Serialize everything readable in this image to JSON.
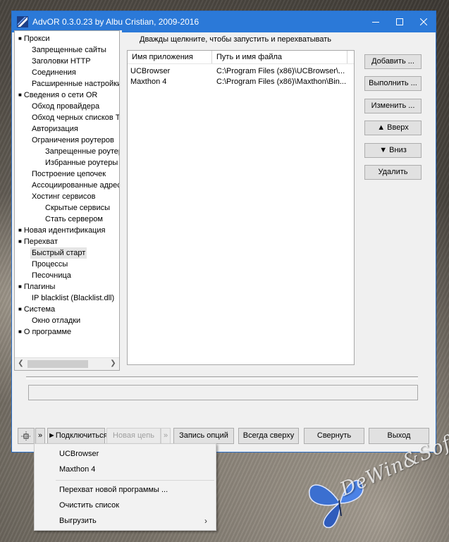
{
  "window": {
    "title": "AdvOR  0.3.0.23 by Albu Cristian, 2009-2016",
    "titlebar_color": "#2b79d8"
  },
  "tree": {
    "items": [
      {
        "label": "Прокси",
        "bullet": true
      },
      {
        "label": "Запрещенные сайты"
      },
      {
        "label": "Заголовки HTTP"
      },
      {
        "label": "Соединения"
      },
      {
        "label": "Расширенные настройки"
      },
      {
        "label": "Сведения о сети OR",
        "bullet": true
      },
      {
        "label": "Обход провайдера"
      },
      {
        "label": "Обход черных списков Т"
      },
      {
        "label": "Авторизация"
      },
      {
        "label": "Ограничения роутеров"
      },
      {
        "label": "Запрещенные роутеры"
      },
      {
        "label": "Избранные роутеры"
      },
      {
        "label": "Построение цепочек"
      },
      {
        "label": "Ассоциированные адрес"
      },
      {
        "label": "Хостинг сервисов"
      },
      {
        "label": "Скрытые сервисы"
      },
      {
        "label": "Стать сервером"
      },
      {
        "label": "Новая идентификация",
        "bullet": true
      },
      {
        "label": "Перехват",
        "bullet": true
      },
      {
        "label": "Быстрый старт",
        "selected": true
      },
      {
        "label": "Процессы"
      },
      {
        "label": "Песочница"
      },
      {
        "label": "Плагины",
        "bullet": true
      },
      {
        "label": "IP blacklist (Blacklist.dll)"
      },
      {
        "label": "Система",
        "bullet": true
      },
      {
        "label": "Окно отладки"
      },
      {
        "label": "О программе",
        "bullet": true
      }
    ]
  },
  "panel": {
    "hint": "Дважды щелкните, чтобы запустить и перехватывать",
    "columns": [
      "Имя приложения",
      "Путь и имя файла"
    ],
    "rows": [
      [
        "UCBrowser",
        "C:\\Program Files (x86)\\UCBrowser\\..."
      ],
      [
        "Maxthon 4",
        "C:\\Program Files (x86)\\Maxthon\\Bin..."
      ]
    ],
    "buttons": [
      "Добавить ...",
      "Выполнить ...",
      "Изменить ...",
      "▲ Вверх",
      "▼ Вниз",
      "Удалить"
    ]
  },
  "bottom_bar": {
    "chevron": "»",
    "connect": "►Подключиться",
    "new_chain": "Новая цепь",
    "chevron2": "»",
    "save_options": "Запись опций",
    "always_on_top": "Всегда сверху",
    "minimize": "Свернуть",
    "exit": "Выход"
  },
  "context_menu": {
    "items": [
      "UCBrowser",
      "Maxthon 4",
      "Перехват новой программы ...",
      "Очистить список",
      "Выгрузить"
    ]
  },
  "watermark": {
    "text": "DeWin&Soft"
  },
  "icons": {
    "app": "advor-logo-icon",
    "butterfly": "butterfly-icon"
  }
}
